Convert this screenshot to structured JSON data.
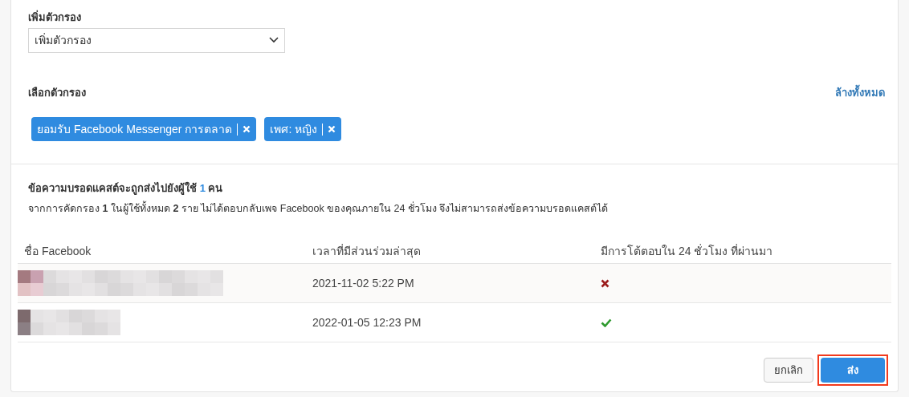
{
  "add_filter": {
    "label": "เพิ่มตัวกรอง",
    "value": "เพิ่มตัวกรอง"
  },
  "selected_filters": {
    "label": "เลือกตัวกรอง",
    "clear_all": "ล้างทั้งหมด",
    "chips": [
      {
        "label": "ยอมรับ Facebook Messenger การตลาด"
      },
      {
        "label": "เพศ: หญิง"
      }
    ]
  },
  "summary": {
    "before": "ข้อความบรอดแคสต์จะถูกส่งไปยังผู้ใช้",
    "count": "1",
    "after": "คน",
    "note": "จากการคัดกรอง **1** ในผู้ใช้ทั้งหมด **2** ราย ไม่ได้ตอบกลับเพจ Facebook ของคุณภายใน 24 ชั่วโมง จึงไม่สามารถส่งข้อความบรอดแคสต์ได้"
  },
  "table": {
    "columns": [
      "ชื่อ Facebook",
      "เวลาที่มีส่วนร่วมล่าสุด",
      "มีการโต้ตอบใน 24 ชั่วโมง ที่ผ่านมา"
    ],
    "rows": [
      {
        "last_engaged": "2021-11-02 5:22 PM",
        "responded": false
      },
      {
        "last_engaged": "2022-01-05 12:23 PM",
        "responded": true
      }
    ]
  },
  "buttons": {
    "cancel": "ยกเลิก",
    "send": {
      "label": "ส่ง",
      "highlighted": true
    }
  }
}
